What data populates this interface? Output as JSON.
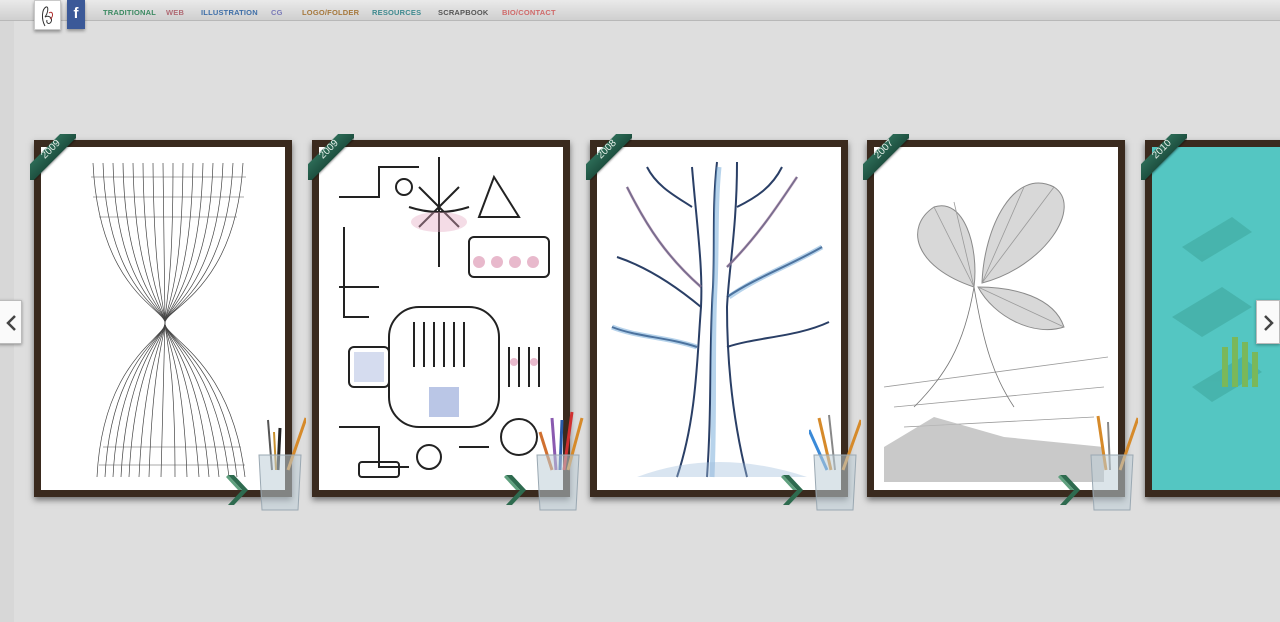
{
  "header": {
    "logo_icon": "signature-logo-icon",
    "facebook_label": "f",
    "nav": [
      {
        "label": "TRADITIONAL",
        "color": "#3c8a62"
      },
      {
        "label": "WEB",
        "color": "#b06a74"
      },
      {
        "label": "ILLUSTRATION",
        "color": "#3f6fa8"
      },
      {
        "label": "CG",
        "color": "#7a7ab8"
      },
      {
        "label": "LOGO/FOLDER",
        "color": "#a6783c"
      },
      {
        "label": "RESOURCES",
        "color": "#3f8a8f"
      },
      {
        "label": "SCRAPBOOK",
        "color": "#555555"
      },
      {
        "label": "BIO/CONTACT",
        "color": "#d06a6a"
      }
    ]
  },
  "gallery": {
    "items": [
      {
        "year": "2009",
        "artwork": "hourglass-lines"
      },
      {
        "year": "2009",
        "artwork": "machine-diagram"
      },
      {
        "year": "2008",
        "artwork": "tree-drawing"
      },
      {
        "year": "2007",
        "artwork": "butterfly-sketch"
      },
      {
        "year": "2010",
        "artwork": "isometric-city"
      }
    ],
    "prev_icon": "chevron-left-icon",
    "next_icon": "chevron-right-icon",
    "frame_color": "#3a2a1e",
    "ribbon_color": "#2c6b56"
  }
}
